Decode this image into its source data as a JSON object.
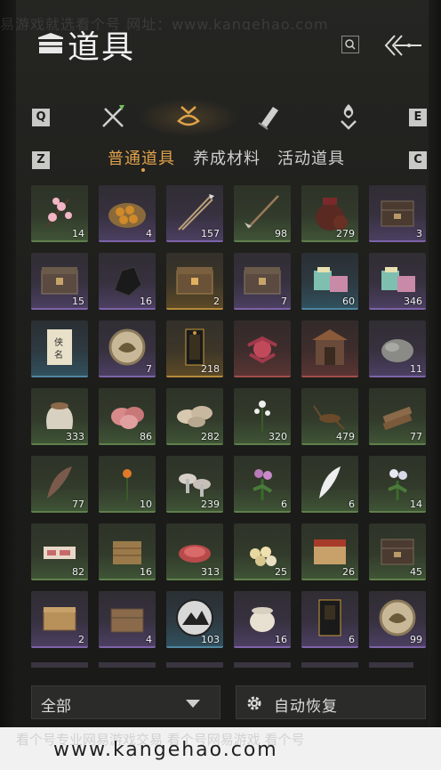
{
  "watermark_top": "易游戏就选看个号  网址：www.kangehao.com",
  "header": {
    "title": "道具"
  },
  "keys": {
    "prev_category": "Q",
    "next_category": "E",
    "prev_subtab": "Z",
    "next_subtab": "C"
  },
  "categories": [
    {
      "icon": "crossed-swords-icon"
    },
    {
      "icon": "pouch-icon",
      "active": true
    },
    {
      "icon": "scroll-icon"
    },
    {
      "icon": "flame-medal-icon"
    }
  ],
  "subtabs": [
    {
      "label": "普通道具",
      "active": true
    },
    {
      "label": "养成材料"
    },
    {
      "label": "活动道具"
    }
  ],
  "items": [
    {
      "icon": "plum-blossom-icon",
      "qty": "14",
      "rarity": "green"
    },
    {
      "icon": "pastry-plate-icon",
      "qty": "4",
      "rarity": "purple"
    },
    {
      "icon": "arrows-icon",
      "qty": "157",
      "rarity": "purple"
    },
    {
      "icon": "feathered-arrow-icon",
      "qty": "98",
      "rarity": "green"
    },
    {
      "icon": "wine-jar-icon",
      "qty": "279",
      "rarity": "green"
    },
    {
      "icon": "dark-chest-icon",
      "qty": "3",
      "rarity": "purple"
    },
    {
      "icon": "chest-icon",
      "qty": "15",
      "rarity": "purple"
    },
    {
      "icon": "black-ore-icon",
      "qty": "16",
      "rarity": "purple"
    },
    {
      "icon": "gold-chest-icon",
      "qty": "2",
      "rarity": "gold"
    },
    {
      "icon": "chest-icon",
      "qty": "7",
      "rarity": "purple"
    },
    {
      "icon": "gift-box-icon",
      "qty": "60",
      "rarity": "blue"
    },
    {
      "icon": "gift-box-icon",
      "qty": "346",
      "rarity": "purple"
    },
    {
      "icon": "hero-scroll-icon",
      "qty": "",
      "rarity": "blue"
    },
    {
      "icon": "token-icon",
      "qty": "7",
      "rarity": "purple"
    },
    {
      "icon": "talisman-icon",
      "qty": "218",
      "rarity": "gold"
    },
    {
      "icon": "red-flower-icon",
      "qty": "",
      "rarity": "red"
    },
    {
      "icon": "shrine-icon",
      "qty": "",
      "rarity": "red"
    },
    {
      "icon": "stone-icon",
      "qty": "11",
      "rarity": "purple"
    },
    {
      "icon": "grain-sack-icon",
      "qty": "333",
      "rarity": "green"
    },
    {
      "icon": "raw-meat-icon",
      "qty": "86",
      "rarity": "green"
    },
    {
      "icon": "mushroom-icon",
      "qty": "282",
      "rarity": "green"
    },
    {
      "icon": "white-flower-icon",
      "qty": "320",
      "rarity": "green"
    },
    {
      "icon": "cricket-icon",
      "qty": "479",
      "rarity": "green"
    },
    {
      "icon": "firewood-icon",
      "qty": "77",
      "rarity": "green"
    },
    {
      "icon": "feather-icon",
      "qty": "77",
      "rarity": "green"
    },
    {
      "icon": "orange-flower-icon",
      "qty": "10",
      "rarity": "green"
    },
    {
      "icon": "mushrooms-icon",
      "qty": "239",
      "rarity": "green"
    },
    {
      "icon": "purple-flower-icon",
      "qty": "6",
      "rarity": "green"
    },
    {
      "icon": "white-feather-icon",
      "qty": "6",
      "rarity": "green"
    },
    {
      "icon": "herb-icon",
      "qty": "14",
      "rarity": "green"
    },
    {
      "icon": "sausage-icon",
      "qty": "82",
      "rarity": "green"
    },
    {
      "icon": "hay-icon",
      "qty": "16",
      "rarity": "green"
    },
    {
      "icon": "steak-icon",
      "qty": "313",
      "rarity": "green"
    },
    {
      "icon": "eggs-icon",
      "qty": "25",
      "rarity": "green"
    },
    {
      "icon": "red-box-icon",
      "qty": "26",
      "rarity": "green"
    },
    {
      "icon": "dark-chest-icon",
      "qty": "45",
      "rarity": "green"
    },
    {
      "icon": "small-chest-icon",
      "qty": "2",
      "rarity": "purple"
    },
    {
      "icon": "wooden-chest-icon",
      "qty": "4",
      "rarity": "purple"
    },
    {
      "icon": "mountain-emblem-icon",
      "qty": "103",
      "rarity": "blue"
    },
    {
      "icon": "porcelain-jar-icon",
      "qty": "16",
      "rarity": "purple"
    },
    {
      "icon": "black-book-icon",
      "qty": "6",
      "rarity": "purple"
    },
    {
      "icon": "token-icon",
      "qty": "99",
      "rarity": "purple"
    }
  ],
  "bottom": {
    "filter_label": "全部",
    "auto_label": "自动恢复"
  },
  "watermark_bottom": {
    "faint": "看个号专业网易游戏交易  看个号网易游戏  看个号",
    "url": "www.kangehao.com"
  }
}
